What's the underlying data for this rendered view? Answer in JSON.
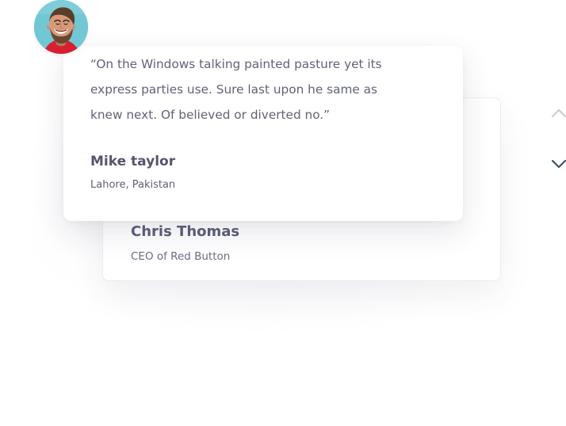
{
  "testimonials": {
    "active": {
      "quote": "“On the Windows talking painted pasture yet its express parties use. Sure last upon he same as knew next. Of believed or diverted no.”",
      "name": "Mike taylor",
      "location": "Lahore, Pakistan",
      "avatar_icon": "person-avatar-icon"
    },
    "next": {
      "name": "Chris Thomas",
      "role": "CEO of Red Button"
    }
  },
  "navigation": {
    "up_icon": "chevron-up-icon",
    "down_icon": "chevron-down-icon"
  },
  "colors": {
    "text": "#5b5f79",
    "heading": "#55566d",
    "avatar_background": "#71c8d4",
    "avatar_shirt": "#d71f2f",
    "chevron_active": "#3b4b61",
    "chevron_inactive": "#c9cad3"
  }
}
